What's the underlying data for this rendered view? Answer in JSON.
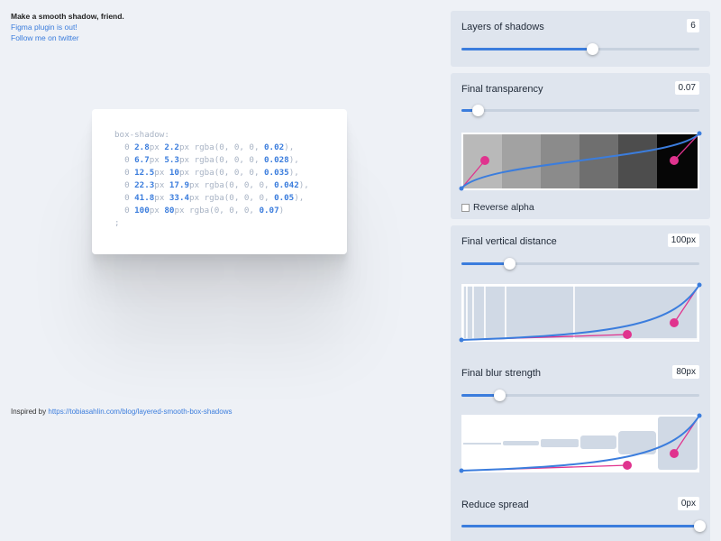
{
  "intro": {
    "title": "Make a smooth shadow, friend.",
    "figma_link": "Figma plugin is out!",
    "twitter_link": "Follow me on twitter"
  },
  "inspired": {
    "label": "Inspired by",
    "link": "https://tobiasahlin.com/blog/layered-smooth-box-shadows"
  },
  "code": {
    "property": "box-shadow:",
    "lines": [
      {
        "x": "0",
        "y": "2.8",
        "blur": "2.2",
        "rgba": "rgba(0, 0, 0, ",
        "alpha": "0.02",
        "end": "),"
      },
      {
        "x": "0",
        "y": "6.7",
        "blur": "5.3",
        "rgba": "rgba(0, 0, 0, ",
        "alpha": "0.028",
        "end": "),"
      },
      {
        "x": "0",
        "y": "12.5",
        "blur": "10",
        "rgba": "rgba(0, 0, 0, ",
        "alpha": "0.035",
        "end": "),"
      },
      {
        "x": "0",
        "y": "22.3",
        "blur": "17.9",
        "rgba": "rgba(0, 0, 0, ",
        "alpha": "0.042",
        "end": "),"
      },
      {
        "x": "0",
        "y": "41.8",
        "blur": "33.4",
        "rgba": "rgba(0, 0, 0, ",
        "alpha": "0.05",
        "end": "),"
      },
      {
        "x": "0",
        "y": "100",
        "blur": "80",
        "rgba": "rgba(0, 0, 0, ",
        "alpha": "0.07",
        "end": ")"
      }
    ],
    "unit": "px",
    "terminator": ";"
  },
  "panels": {
    "layers": {
      "label": "Layers of shadows",
      "value": "6",
      "slider_fraction": 0.55
    },
    "transparency": {
      "label": "Final transparency",
      "value": "0.07",
      "slider_fraction": 0.07,
      "reverse_label": "Reverse alpha",
      "reverse_checked": false
    },
    "distance": {
      "label": "Final vertical distance",
      "value": "100px",
      "slider_fraction": 0.2
    },
    "blur": {
      "label": "Final blur strength",
      "value": "80px",
      "slider_fraction": 0.16
    },
    "spread": {
      "label": "Reduce spread",
      "value": "0px",
      "slider_fraction": 1.0
    }
  },
  "colors": {
    "accent": "#3b7ddd",
    "handle": "#e0338e",
    "panel_bg": "#dfe5ee",
    "page_bg": "#eef1f6"
  }
}
